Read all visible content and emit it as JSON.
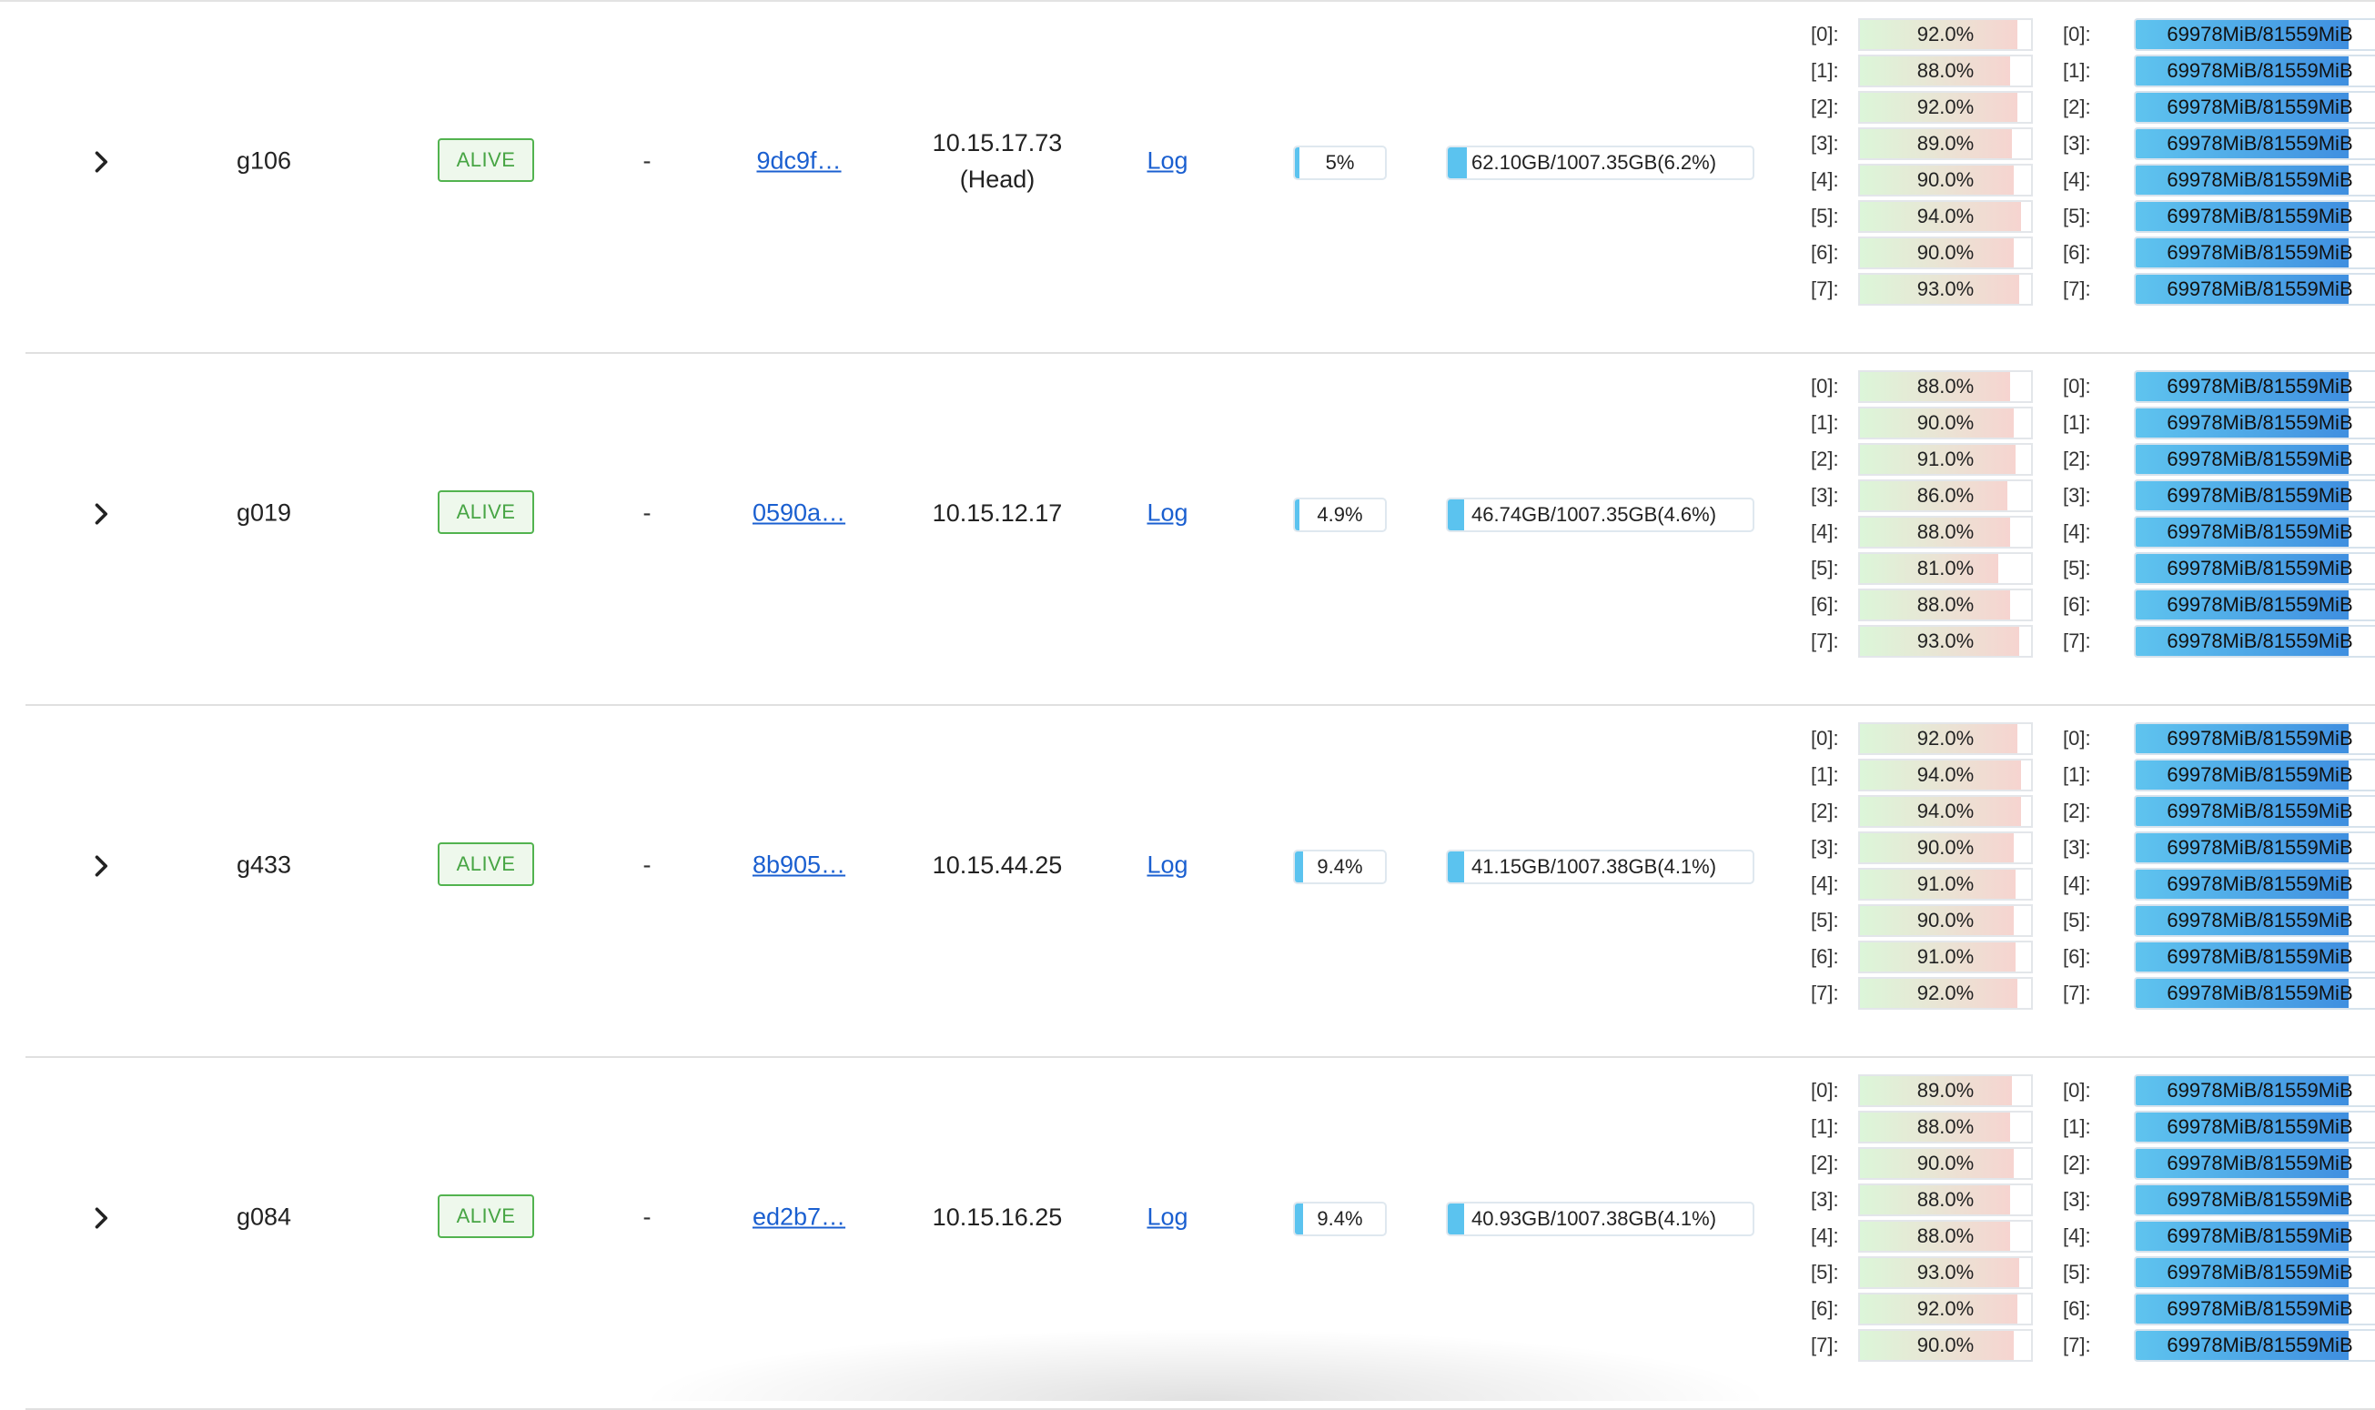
{
  "nodes": [
    {
      "hostname": "g106",
      "state": "ALIVE",
      "dash": "-",
      "node_id": "9dc9f…",
      "ip": "10.15.17.73",
      "ip_note": "(Head)",
      "log": "Log",
      "cpu": {
        "text": "5%",
        "fraction": 0.05
      },
      "memory": {
        "text": "62.10GB/1007.35GB(6.2%)",
        "fraction": 0.062
      },
      "gpus": [
        {
          "index": "[0]:",
          "text": "92.0%",
          "fraction": 0.92
        },
        {
          "index": "[1]:",
          "text": "88.0%",
          "fraction": 0.88
        },
        {
          "index": "[2]:",
          "text": "92.0%",
          "fraction": 0.92
        },
        {
          "index": "[3]:",
          "text": "89.0%",
          "fraction": 0.89
        },
        {
          "index": "[4]:",
          "text": "90.0%",
          "fraction": 0.9
        },
        {
          "index": "[5]:",
          "text": "94.0%",
          "fraction": 0.94
        },
        {
          "index": "[6]:",
          "text": "90.0%",
          "fraction": 0.9
        },
        {
          "index": "[7]:",
          "text": "93.0%",
          "fraction": 0.93
        }
      ],
      "gram": [
        {
          "index": "[0]:",
          "text": "69978MiB/81559MiB",
          "fraction": 0.858
        },
        {
          "index": "[1]:",
          "text": "69978MiB/81559MiB",
          "fraction": 0.858
        },
        {
          "index": "[2]:",
          "text": "69978MiB/81559MiB",
          "fraction": 0.858
        },
        {
          "index": "[3]:",
          "text": "69978MiB/81559MiB",
          "fraction": 0.858
        },
        {
          "index": "[4]:",
          "text": "69978MiB/81559MiB",
          "fraction": 0.858
        },
        {
          "index": "[5]:",
          "text": "69978MiB/81559MiB",
          "fraction": 0.858
        },
        {
          "index": "[6]:",
          "text": "69978MiB/81559MiB",
          "fraction": 0.858
        },
        {
          "index": "[7]:",
          "text": "69978MiB/81559MiB",
          "fraction": 0.858
        }
      ]
    },
    {
      "hostname": "g019",
      "state": "ALIVE",
      "dash": "-",
      "node_id": "0590a…",
      "ip": "10.15.12.17",
      "ip_note": "",
      "log": "Log",
      "cpu": {
        "text": "4.9%",
        "fraction": 0.049
      },
      "memory": {
        "text": "46.74GB/1007.35GB(4.6%)",
        "fraction": 0.046
      },
      "gpus": [
        {
          "index": "[0]:",
          "text": "88.0%",
          "fraction": 0.88
        },
        {
          "index": "[1]:",
          "text": "90.0%",
          "fraction": 0.9
        },
        {
          "index": "[2]:",
          "text": "91.0%",
          "fraction": 0.91
        },
        {
          "index": "[3]:",
          "text": "86.0%",
          "fraction": 0.86
        },
        {
          "index": "[4]:",
          "text": "88.0%",
          "fraction": 0.88
        },
        {
          "index": "[5]:",
          "text": "81.0%",
          "fraction": 0.81
        },
        {
          "index": "[6]:",
          "text": "88.0%",
          "fraction": 0.88
        },
        {
          "index": "[7]:",
          "text": "93.0%",
          "fraction": 0.93
        }
      ],
      "gram": [
        {
          "index": "[0]:",
          "text": "69978MiB/81559MiB",
          "fraction": 0.858
        },
        {
          "index": "[1]:",
          "text": "69978MiB/81559MiB",
          "fraction": 0.858
        },
        {
          "index": "[2]:",
          "text": "69978MiB/81559MiB",
          "fraction": 0.858
        },
        {
          "index": "[3]:",
          "text": "69978MiB/81559MiB",
          "fraction": 0.858
        },
        {
          "index": "[4]:",
          "text": "69978MiB/81559MiB",
          "fraction": 0.858
        },
        {
          "index": "[5]:",
          "text": "69978MiB/81559MiB",
          "fraction": 0.858
        },
        {
          "index": "[6]:",
          "text": "69978MiB/81559MiB",
          "fraction": 0.858
        },
        {
          "index": "[7]:",
          "text": "69978MiB/81559MiB",
          "fraction": 0.858
        }
      ]
    },
    {
      "hostname": "g433",
      "state": "ALIVE",
      "dash": "-",
      "node_id": "8b905…",
      "ip": "10.15.44.25",
      "ip_note": "",
      "log": "Log",
      "cpu": {
        "text": "9.4%",
        "fraction": 0.094
      },
      "memory": {
        "text": "41.15GB/1007.38GB(4.1%)",
        "fraction": 0.041
      },
      "gpus": [
        {
          "index": "[0]:",
          "text": "92.0%",
          "fraction": 0.92
        },
        {
          "index": "[1]:",
          "text": "94.0%",
          "fraction": 0.94
        },
        {
          "index": "[2]:",
          "text": "94.0%",
          "fraction": 0.94
        },
        {
          "index": "[3]:",
          "text": "90.0%",
          "fraction": 0.9
        },
        {
          "index": "[4]:",
          "text": "91.0%",
          "fraction": 0.91
        },
        {
          "index": "[5]:",
          "text": "90.0%",
          "fraction": 0.9
        },
        {
          "index": "[6]:",
          "text": "91.0%",
          "fraction": 0.91
        },
        {
          "index": "[7]:",
          "text": "92.0%",
          "fraction": 0.92
        }
      ],
      "gram": [
        {
          "index": "[0]:",
          "text": "69978MiB/81559MiB",
          "fraction": 0.858
        },
        {
          "index": "[1]:",
          "text": "69978MiB/81559MiB",
          "fraction": 0.858
        },
        {
          "index": "[2]:",
          "text": "69978MiB/81559MiB",
          "fraction": 0.858
        },
        {
          "index": "[3]:",
          "text": "69978MiB/81559MiB",
          "fraction": 0.858
        },
        {
          "index": "[4]:",
          "text": "69978MiB/81559MiB",
          "fraction": 0.858
        },
        {
          "index": "[5]:",
          "text": "69978MiB/81559MiB",
          "fraction": 0.858
        },
        {
          "index": "[6]:",
          "text": "69978MiB/81559MiB",
          "fraction": 0.858
        },
        {
          "index": "[7]:",
          "text": "69978MiB/81559MiB",
          "fraction": 0.858
        }
      ]
    },
    {
      "hostname": "g084",
      "state": "ALIVE",
      "dash": "-",
      "node_id": "ed2b7…",
      "ip": "10.15.16.25",
      "ip_note": "",
      "log": "Log",
      "cpu": {
        "text": "9.4%",
        "fraction": 0.094
      },
      "memory": {
        "text": "40.93GB/1007.38GB(4.1%)",
        "fraction": 0.041
      },
      "gpus": [
        {
          "index": "[0]:",
          "text": "89.0%",
          "fraction": 0.89
        },
        {
          "index": "[1]:",
          "text": "88.0%",
          "fraction": 0.88
        },
        {
          "index": "[2]:",
          "text": "90.0%",
          "fraction": 0.9
        },
        {
          "index": "[3]:",
          "text": "88.0%",
          "fraction": 0.88
        },
        {
          "index": "[4]:",
          "text": "88.0%",
          "fraction": 0.88
        },
        {
          "index": "[5]:",
          "text": "93.0%",
          "fraction": 0.93
        },
        {
          "index": "[6]:",
          "text": "92.0%",
          "fraction": 0.92
        },
        {
          "index": "[7]:",
          "text": "90.0%",
          "fraction": 0.9
        }
      ],
      "gram": [
        {
          "index": "[0]:",
          "text": "69978MiB/81559MiB",
          "fraction": 0.858
        },
        {
          "index": "[1]:",
          "text": "69978MiB/81559MiB",
          "fraction": 0.858
        },
        {
          "index": "[2]:",
          "text": "69978MiB/81559MiB",
          "fraction": 0.858
        },
        {
          "index": "[3]:",
          "text": "69978MiB/81559MiB",
          "fraction": 0.858
        },
        {
          "index": "[4]:",
          "text": "69978MiB/81559MiB",
          "fraction": 0.858
        },
        {
          "index": "[5]:",
          "text": "69978MiB/81559MiB",
          "fraction": 0.858
        },
        {
          "index": "[6]:",
          "text": "69978MiB/81559MiB",
          "fraction": 0.858
        },
        {
          "index": "[7]:",
          "text": "69978MiB/81559MiB",
          "fraction": 0.858
        }
      ]
    }
  ],
  "icons": {
    "expand": "chevron-right-icon"
  },
  "colors": {
    "alive": "#52b34f",
    "link": "#1a5fd0",
    "bar": "#5bc3ef"
  }
}
